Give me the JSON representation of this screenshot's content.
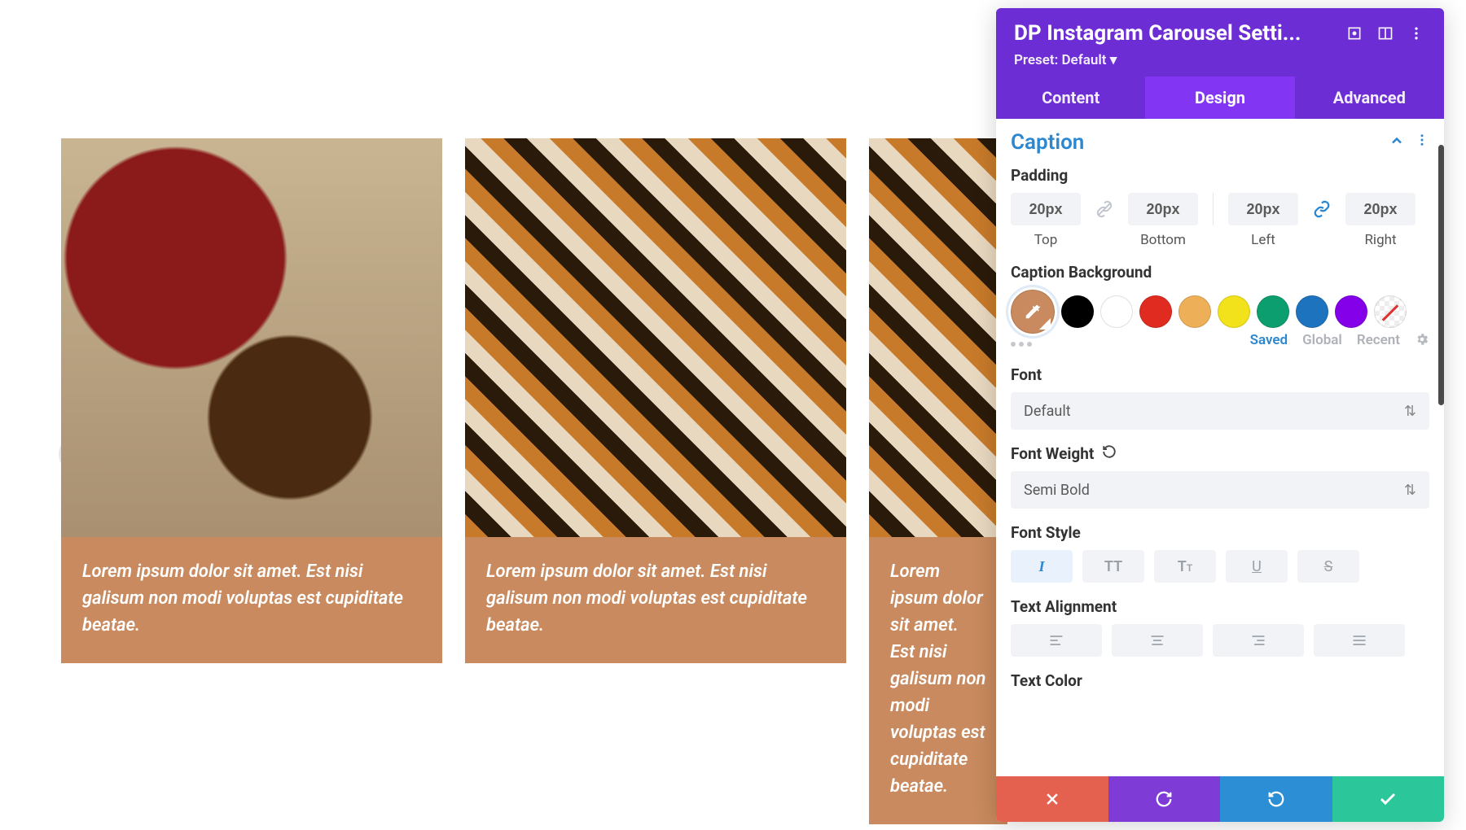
{
  "panel": {
    "title": "DP Instagram Carousel Setti...",
    "preset_label": "Preset: Default",
    "tabs": {
      "content": "Content",
      "design": "Design",
      "advanced": "Advanced"
    }
  },
  "section": {
    "title": "Caption"
  },
  "padding": {
    "label": "Padding",
    "top": {
      "value": "20px",
      "label": "Top"
    },
    "bottom": {
      "value": "20px",
      "label": "Bottom"
    },
    "left": {
      "value": "20px",
      "label": "Left"
    },
    "right": {
      "value": "20px",
      "label": "Right"
    }
  },
  "caption_bg": {
    "label": "Caption Background",
    "swatches": [
      "#000000",
      "#ffffff",
      "#e02b20",
      "#edb059",
      "#f2e21b",
      "#0c9e6e",
      "#1e73be",
      "#8300e9"
    ],
    "modes": {
      "saved": "Saved",
      "global": "Global",
      "recent": "Recent"
    }
  },
  "font": {
    "label": "Font",
    "value": "Default"
  },
  "font_weight": {
    "label": "Font Weight",
    "value": "Semi Bold"
  },
  "font_style": {
    "label": "Font Style"
  },
  "text_align": {
    "label": "Text Alignment"
  },
  "text_color": {
    "label": "Text Color"
  },
  "carousel": {
    "cards": [
      {
        "caption": "Lorem ipsum dolor sit amet. Est nisi galisum non modi voluptas est cupiditate beatae."
      },
      {
        "caption": "Lorem ipsum dolor sit amet. Est nisi galisum non modi voluptas est cupiditate beatae."
      },
      {
        "caption": "Lorem ipsum dolor sit amet. Est nisi galisum non modi voluptas est cupiditate beatae."
      }
    ]
  }
}
